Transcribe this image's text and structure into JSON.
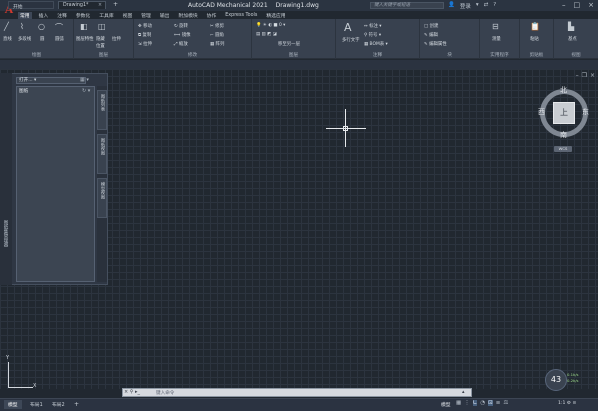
{
  "title_bar": {
    "app_title": "AutoCAD Mechanical 2021",
    "doc_title": "Drawing1.dwg",
    "search_placeholder": "键入关键字或短语",
    "user_label": "登录"
  },
  "ribbon_tabs": [
    "常用",
    "插入",
    "注释",
    "参数化",
    "工具库",
    "视图",
    "管理",
    "输出",
    "附加模块",
    "协作",
    "Express Tools",
    "精选应用"
  ],
  "ribbon": {
    "draw": {
      "title": "绘图",
      "tools": [
        "直线",
        "多段线",
        "圆",
        "圆弧"
      ]
    },
    "layers": {
      "title": "图层",
      "tools": [
        "图层特性",
        "隐藏",
        "位置",
        "拉伸"
      ]
    },
    "modify": {
      "title": "修改",
      "tools": [
        "移动",
        "旋转",
        "修剪",
        "复制",
        "镜像",
        "圆角",
        "拉伸",
        "缩放",
        "阵列"
      ]
    },
    "layer_group": {
      "title": "图层",
      "value": "0",
      "tools": [
        "移至另一层"
      ]
    },
    "annotation": {
      "title": "注释",
      "tools": [
        "标注",
        "多行文字",
        "符号",
        "BOM表"
      ]
    },
    "block": {
      "title": "块",
      "tools": [
        "创建",
        "编辑",
        "编辑属性"
      ]
    },
    "utilities": {
      "title": "实用程序",
      "tools": [
        "测量"
      ]
    },
    "clipboard": {
      "title": "剪贴板",
      "tools": [
        "粘贴"
      ]
    },
    "view": {
      "title": "视图",
      "tools": [
        "基点"
      ]
    }
  },
  "doc_tabs": {
    "start": "开始",
    "drawing": "Drawing1*"
  },
  "palette": {
    "header": "打开...",
    "inner_title": "图纸",
    "side_label": "图纸集管理器",
    "tabs": [
      "图纸列表",
      "图纸视图",
      "模型视图"
    ]
  },
  "viewcube": {
    "north": "北",
    "south": "南",
    "east": "东",
    "west": "西",
    "face": "上",
    "wcs": "WCS"
  },
  "ucs": {
    "x": "X",
    "y": "Y"
  },
  "command_line": {
    "placeholder": "键入命令"
  },
  "status_bar": {
    "layouts": [
      "模型",
      "布局1",
      "布局2"
    ],
    "model_label": "模型",
    "scale": "1:1",
    "badge": "43",
    "net_up": "0.1k/s",
    "net_down": "0.2k/s"
  },
  "colors": {
    "background": "#212830",
    "ribbon": "#38414f",
    "accent": "#48607e",
    "logo": "#d23a2f"
  }
}
